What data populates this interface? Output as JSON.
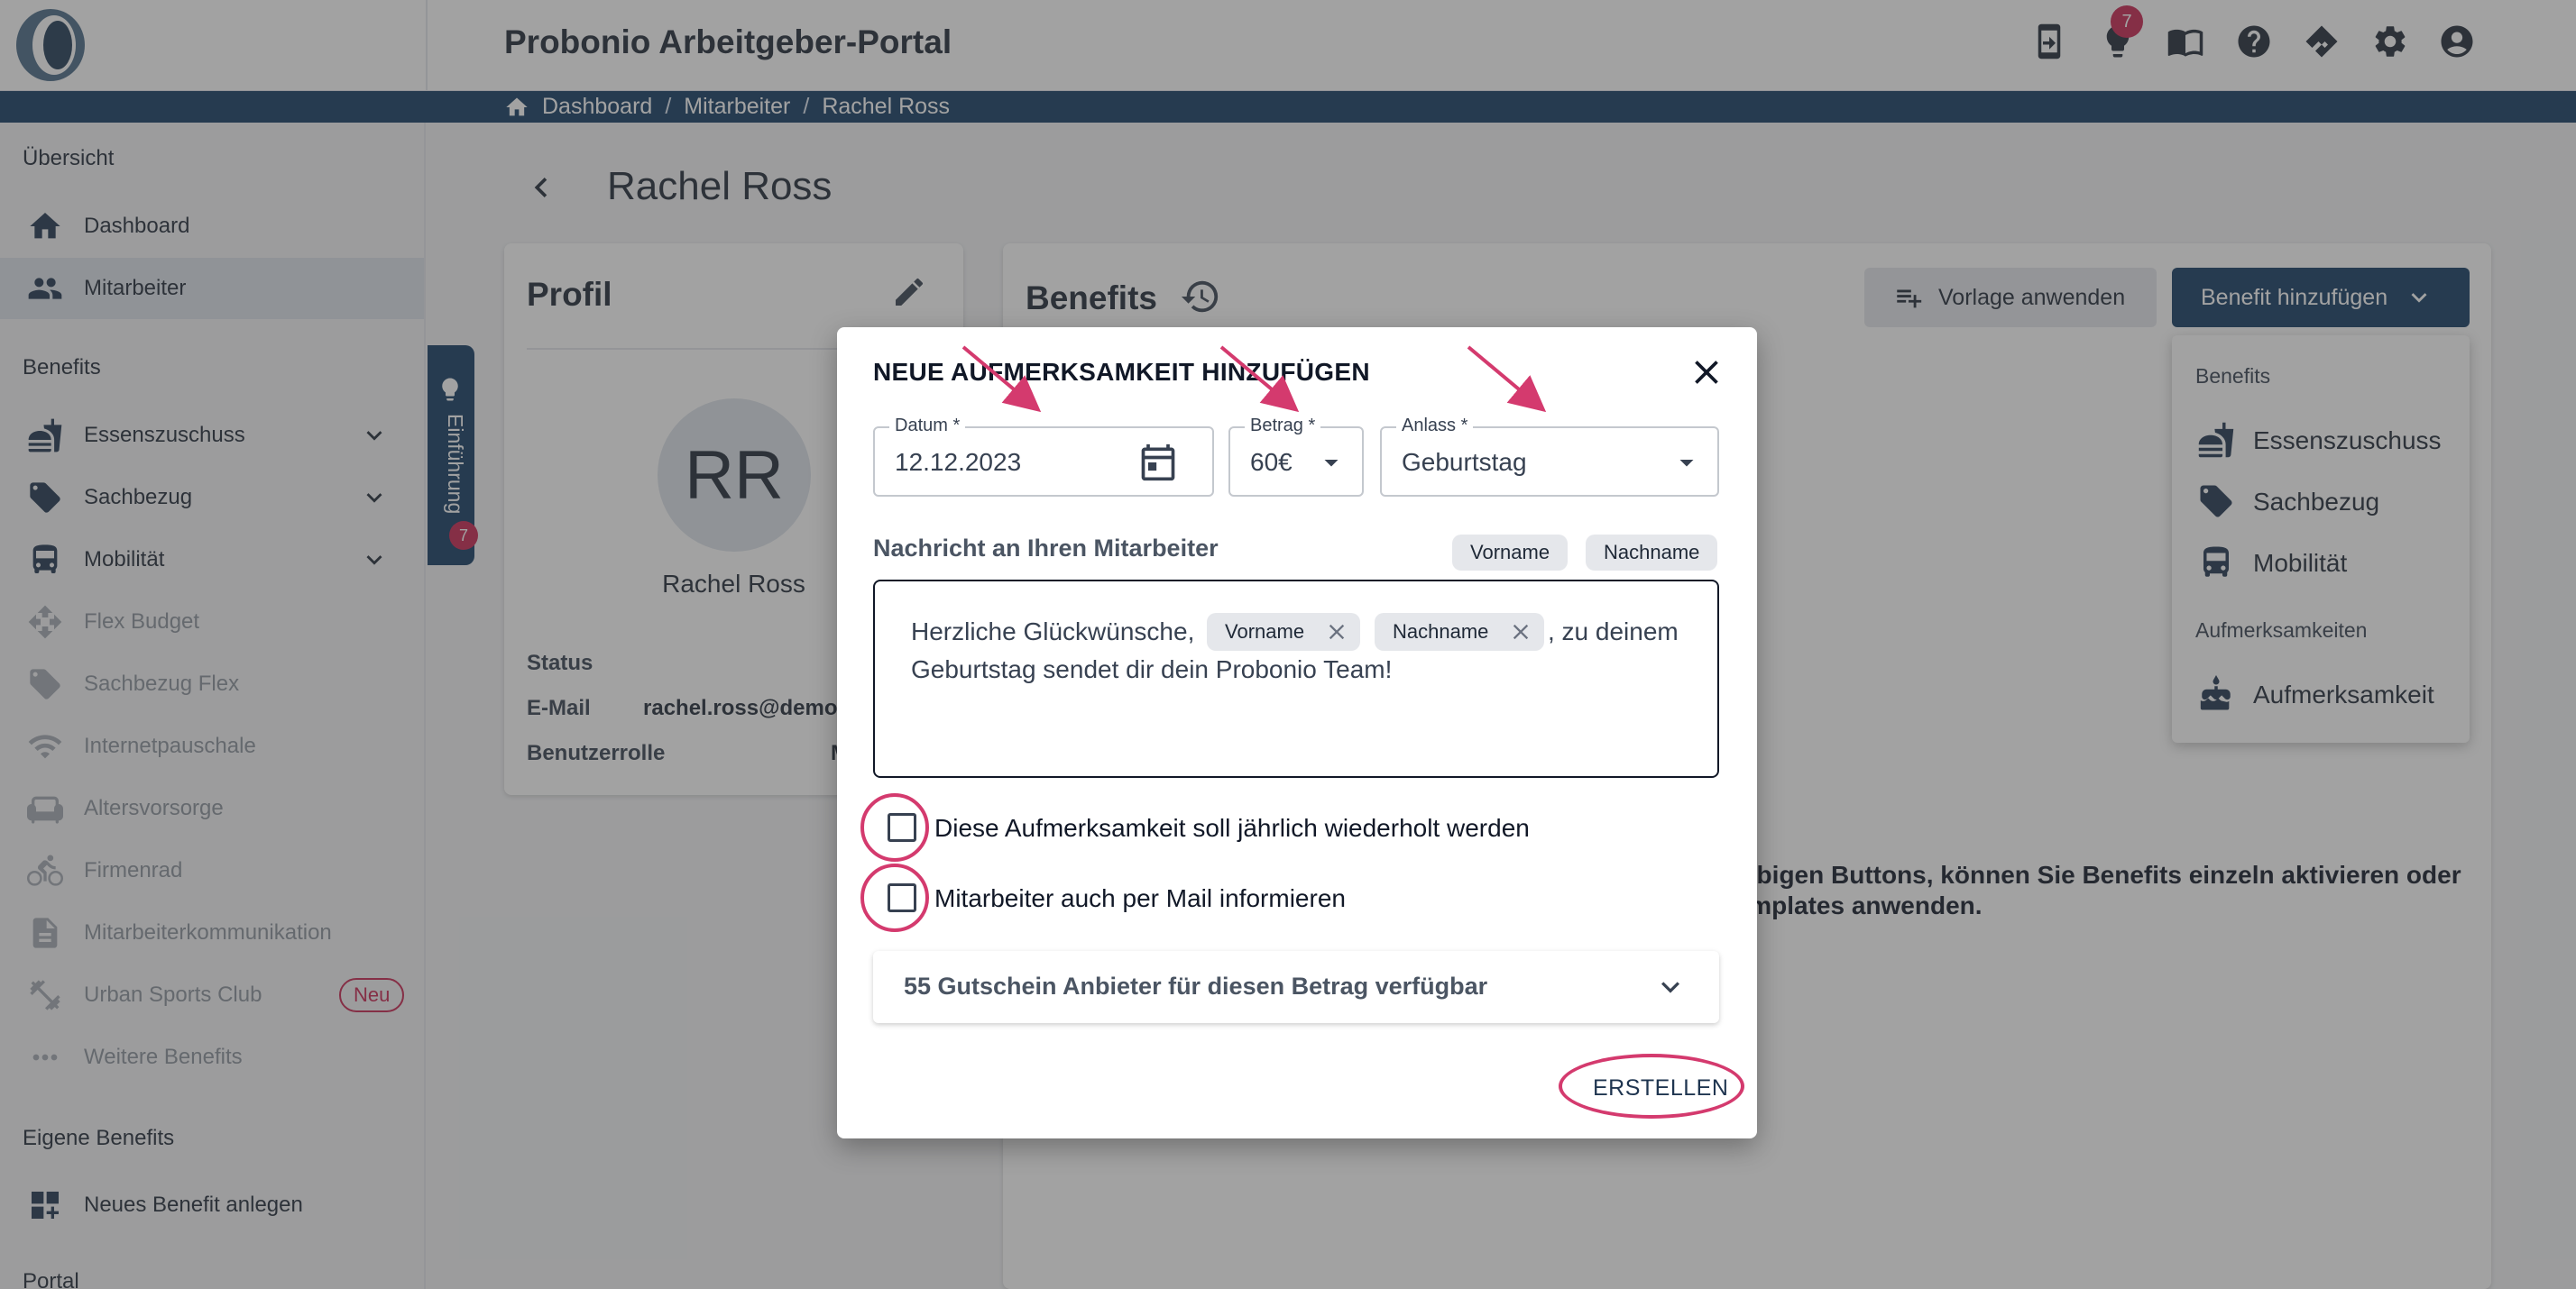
{
  "app": {
    "title": "Probonio Arbeitgeber-Portal"
  },
  "header": {
    "notification_count": "7"
  },
  "breadcrumb": {
    "items": [
      "Dashboard",
      "Mitarbeiter",
      "Rachel Ross"
    ],
    "separator": "/"
  },
  "sidebar": {
    "sections": {
      "overview": "Übersicht",
      "benefits": "Benefits",
      "own": "Eigene Benefits",
      "portal": "Portal"
    },
    "items": [
      {
        "label": "Dashboard",
        "icon": "home-icon"
      },
      {
        "label": "Mitarbeiter",
        "icon": "people-icon"
      },
      {
        "label": "Essenszuschuss",
        "icon": "food-icon"
      },
      {
        "label": "Sachbezug",
        "icon": "tag-icon"
      },
      {
        "label": "Mobilität",
        "icon": "bus-icon"
      },
      {
        "label": "Flex Budget",
        "icon": "flex-icon"
      },
      {
        "label": "Sachbezug Flex",
        "icon": "tag-icon"
      },
      {
        "label": "Internetpauschale",
        "icon": "wifi-icon"
      },
      {
        "label": "Altersvorsorge",
        "icon": "sofa-icon"
      },
      {
        "label": "Firmenrad",
        "icon": "bike-icon"
      },
      {
        "label": "Mitarbeiterkommunikation",
        "icon": "doc-icon"
      },
      {
        "label": "Urban Sports Club",
        "icon": "dumbbell-icon",
        "badge": "Neu"
      },
      {
        "label": "Weitere Benefits",
        "icon": "more-icon"
      },
      {
        "label": "Neues Benefit anlegen",
        "icon": "dashboard-add-icon"
      }
    ],
    "intro_tab": {
      "label": "Einführung",
      "badge": "7"
    }
  },
  "page": {
    "title": "Rachel Ross"
  },
  "profile": {
    "title": "Profil",
    "initials": "RR",
    "name": "Rachel Ross",
    "status_label": "Status",
    "email_label": "E-Mail",
    "email_value": "rachel.ross@demo-",
    "role_label": "Benutzerrolle",
    "role_value": "M"
  },
  "benefits": {
    "title": "Benefits",
    "apply_template": "Vorlage anwenden",
    "add_benefit": "Benefit hinzufügen",
    "hint_line1": "en obigen Buttons, können Sie Benefits einzeln aktivieren oder",
    "hint_line2": "t-Templates anwenden."
  },
  "dropdown": {
    "section_benefits": "Benefits",
    "section_attention": "Aufmerksamkeiten",
    "items": [
      "Essenszuschuss",
      "Sachbezug",
      "Mobilität",
      "Aufmerksamkeit"
    ]
  },
  "modal": {
    "title": "NEUE AUFMERKSAMKEIT HINZUFÜGEN",
    "date": {
      "label": "Datum *",
      "value": "12.12.2023"
    },
    "amount": {
      "label": "Betrag *",
      "value": "60€"
    },
    "occasion": {
      "label": "Anlass *",
      "value": "Geburtstag"
    },
    "message_label": "Nachricht an Ihren Mitarbeiter",
    "chips": [
      "Vorname",
      "Nachname"
    ],
    "message": {
      "prefix": "Herzliche Glückwünsche,",
      "chip1": "Vorname",
      "chip2": "Nachname",
      "suffix": ", zu deinem",
      "line2": "Geburtstag sendet dir dein Probonio Team!"
    },
    "checkbox_yearly": {
      "label": "Diese Aufmerksamkeit soll jährlich wiederholt werden",
      "checked": false
    },
    "checkbox_mail": {
      "label": "Mitarbeiter auch per Mail informieren",
      "checked": false
    },
    "accordion_label": "55 Gutschein Anbieter für diesen Betrag verfügbar",
    "submit": "ERSTELLEN"
  },
  "colors": {
    "primary": "#133b63",
    "accent": "#c8234f",
    "annotation": "#d43a6e"
  }
}
